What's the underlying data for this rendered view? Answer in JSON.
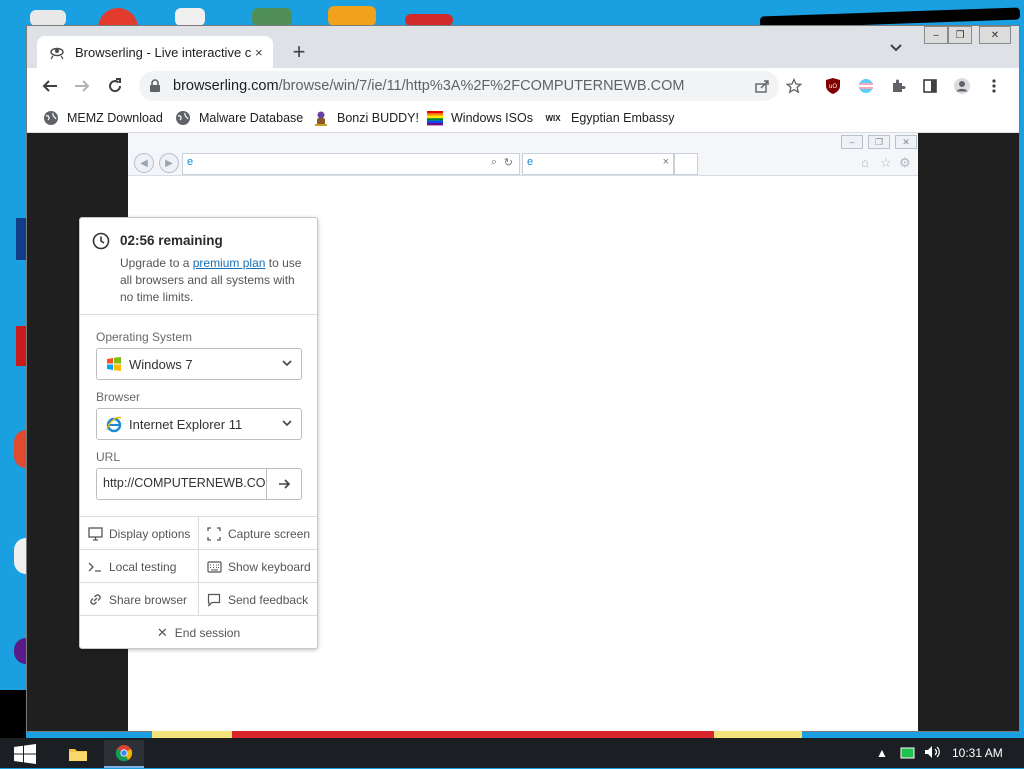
{
  "chrome": {
    "tab_title": "Browserling - Live interactive cross-browser testing",
    "tab_close": "×",
    "new_tab": "+",
    "tab_search": "⌄",
    "url_domain": "browserling.com",
    "url_path": "/browse/win/7/ie/11/http%3A%2F%2FCOMPUTERNEWB.COM"
  },
  "bookmarks": [
    {
      "label": "MEMZ Download",
      "icon": "globe-icon"
    },
    {
      "label": "Malware Database",
      "icon": "globe-icon"
    },
    {
      "label": "Bonzi BUDDY!",
      "icon": "bonzi-icon"
    },
    {
      "label": "Windows ISOs",
      "icon": "rainbow-flag-icon"
    },
    {
      "label": "Egyptian Embassy",
      "icon": "wix-icon"
    }
  ],
  "bookmark_wix": "WIX",
  "panel": {
    "remaining": "02:56 remaining",
    "upgrade_pre": "Upgrade to a ",
    "upgrade_link": "premium plan",
    "upgrade_post": " to use all browsers and all systems with no time limits.",
    "os_label": "Operating System",
    "os_value": "Windows 7",
    "browser_label": "Browser",
    "browser_value": "Internet Explorer 11",
    "url_label": "URL",
    "url_value": "http://COMPUTERNEWB.COM",
    "display_options": "Display options",
    "capture_screen": "Capture screen",
    "local_testing": "Local testing",
    "show_keyboard": "Show keyboard",
    "share_browser": "Share browser",
    "send_feedback": "Send feedback",
    "end_session": "End session"
  },
  "taskbar": {
    "clock": "10:31 AM"
  },
  "colors": {
    "desktop": "#1aa0e0",
    "link": "#1a6fb5",
    "taskbar": "#1b1f24"
  }
}
